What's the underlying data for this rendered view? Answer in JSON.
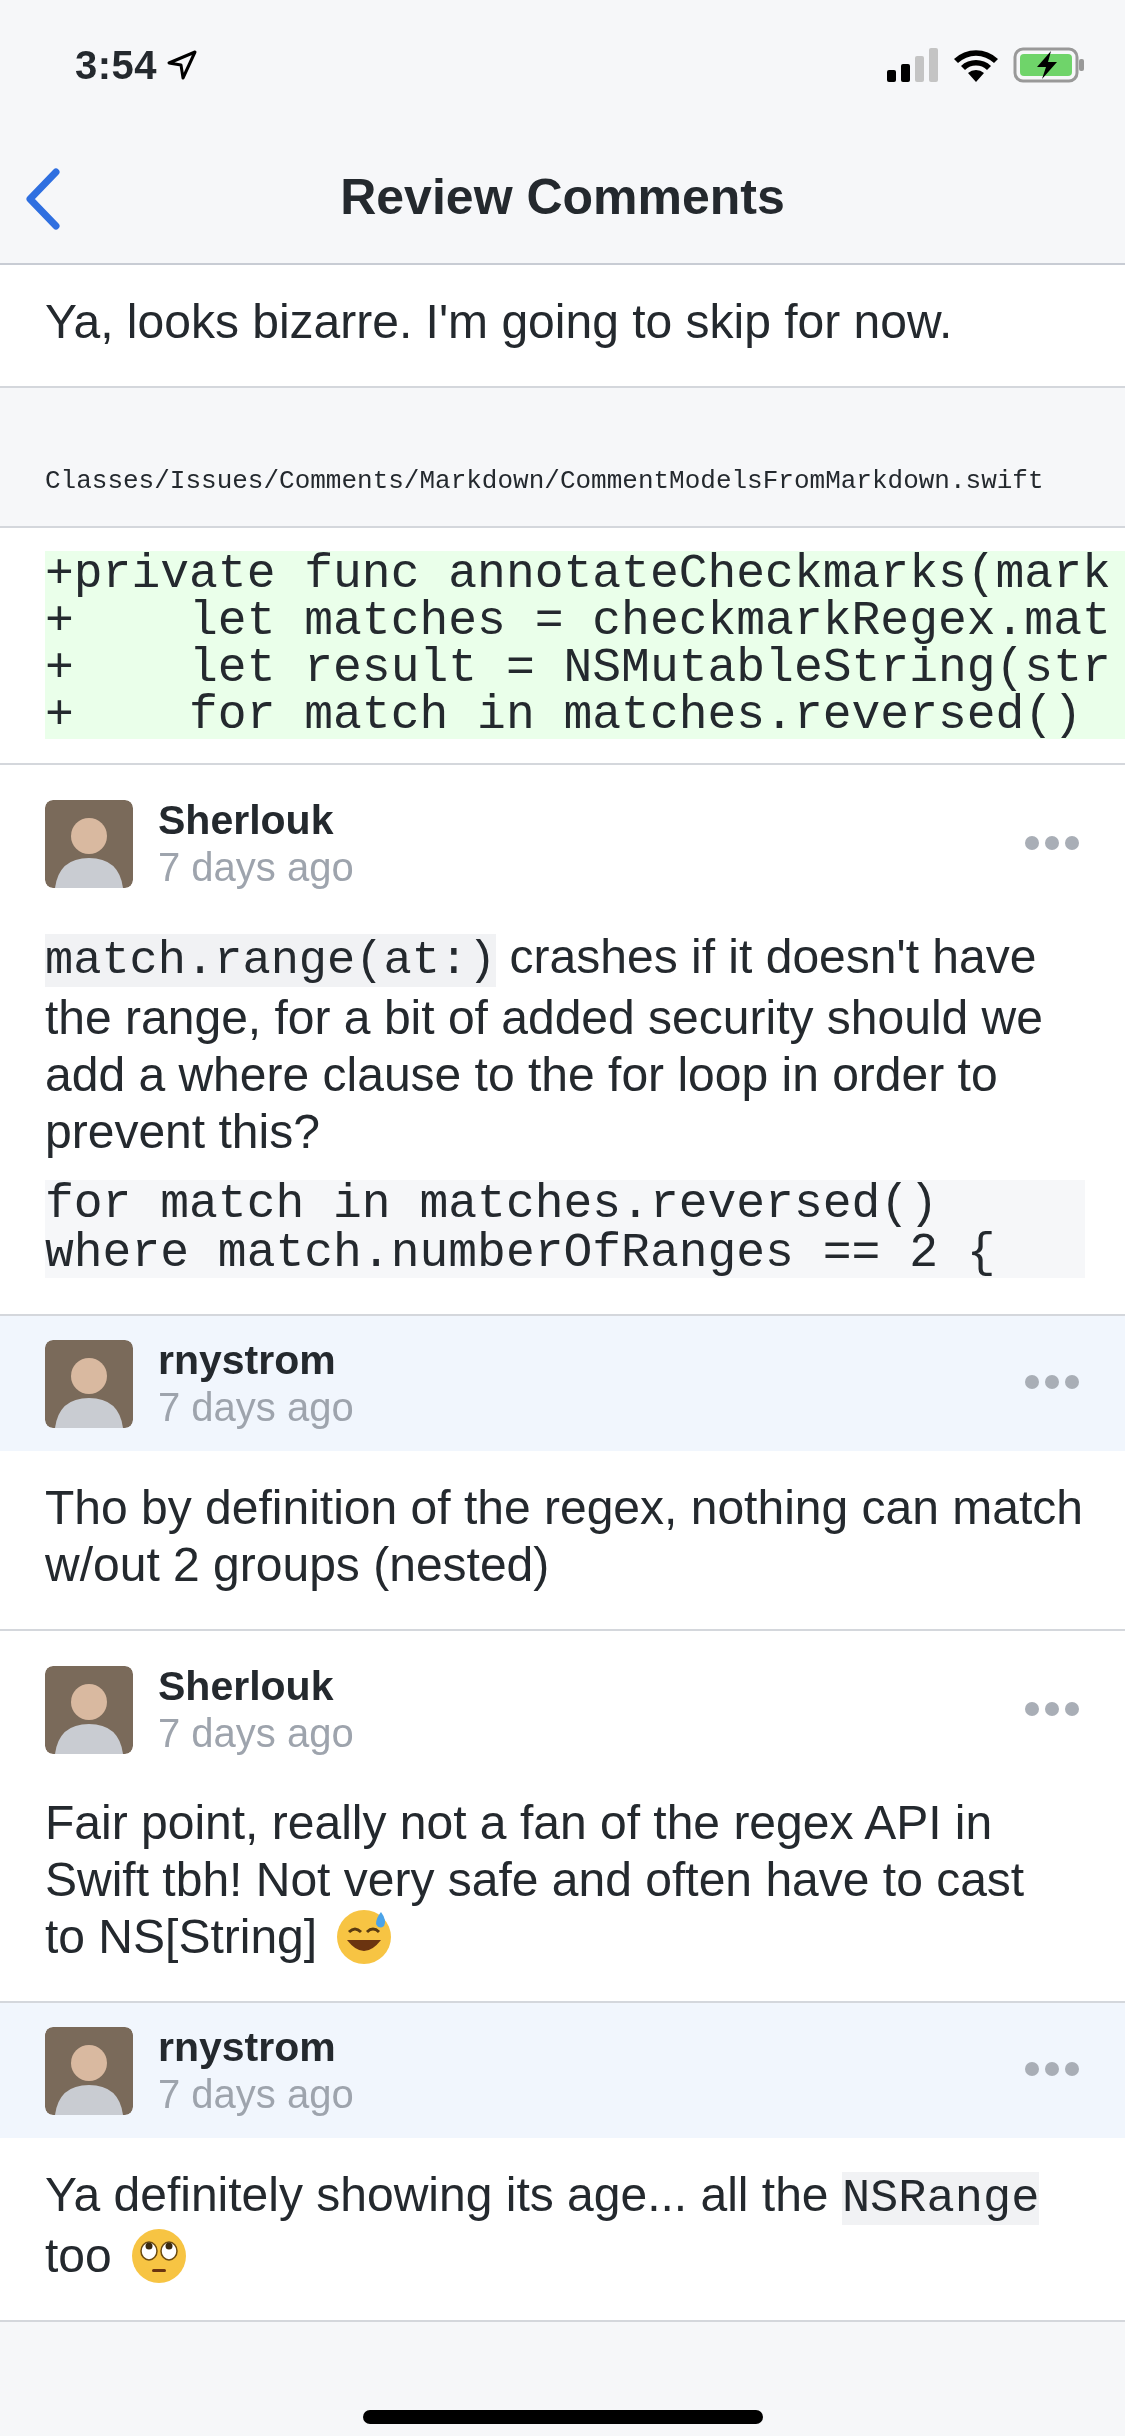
{
  "status_bar": {
    "time": "3:54"
  },
  "nav": {
    "title": "Review Comments"
  },
  "items": [
    {
      "kind": "body",
      "blocks": [
        {
          "kind": "paragraph",
          "segments": [
            {
              "kind": "text",
              "text": "Ya, looks bizarre. I'm going to skip for now."
            }
          ]
        }
      ]
    },
    {
      "kind": "file_path",
      "text": "Classes/Issues/Comments/Markdown/CommentModelsFromMarkdown.swift"
    },
    {
      "kind": "diff",
      "lines": [
        "+private func annotateCheckmarks(mark",
        "+    let matches = checkmarkRegex.mat",
        "+    let result = NSMutableString(str",
        "+    for match in matches.reversed()"
      ]
    },
    {
      "kind": "comment",
      "author": "Sherlouk",
      "time": "7 days ago",
      "highlighted": false,
      "blocks": [
        {
          "kind": "paragraph",
          "segments": [
            {
              "kind": "code",
              "text": "match.range(at:)"
            },
            {
              "kind": "text",
              "text": " crashes if it doesn't have the range, for a bit of added security should we add a where clause to the for loop in order to prevent this?"
            }
          ]
        },
        {
          "kind": "code_block",
          "lines": [
            "for match in matches.reversed()",
            "where match.numberOfRanges == 2 {"
          ]
        }
      ]
    },
    {
      "kind": "comment",
      "author": "rnystrom",
      "time": "7 days ago",
      "highlighted": true,
      "blocks": [
        {
          "kind": "paragraph",
          "segments": [
            {
              "kind": "text",
              "text": "Tho by definition of the regex, nothing can match w/out 2 groups (nested)"
            }
          ]
        }
      ]
    },
    {
      "kind": "comment",
      "author": "Sherlouk",
      "time": "7 days ago",
      "highlighted": false,
      "blocks": [
        {
          "kind": "paragraph",
          "segments": [
            {
              "kind": "text",
              "text": "Fair point, really not a fan of the regex API in Swift tbh! Not very safe and often have to cast"
            }
          ]
        },
        {
          "kind": "line",
          "segments": [
            {
              "kind": "text",
              "text": "to NS[String]"
            },
            {
              "kind": "sweatsmile"
            }
          ]
        }
      ]
    },
    {
      "kind": "comment",
      "author": "rnystrom",
      "time": "7 days ago",
      "highlighted": true,
      "blocks": [
        {
          "kind": "paragraph",
          "segments": [
            {
              "kind": "text",
              "text": "Ya definitely showing its age... all the "
            },
            {
              "kind": "code",
              "text": "NSRange"
            }
          ]
        },
        {
          "kind": "line",
          "segments": [
            {
              "kind": "text",
              "text": "too"
            },
            {
              "kind": "eyeroll"
            }
          ]
        }
      ]
    }
  ]
}
